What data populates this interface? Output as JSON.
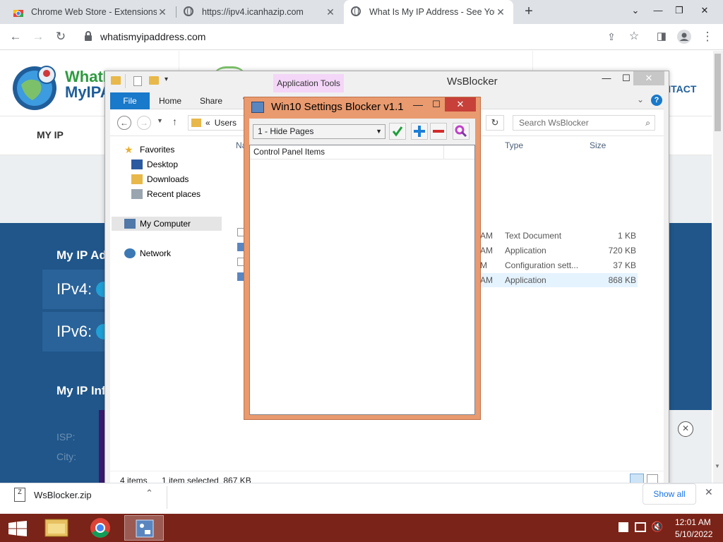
{
  "browser": {
    "tabs": [
      {
        "title": "Chrome Web Store - Extensions",
        "active": false
      },
      {
        "title": "https://ipv4.icanhazip.com",
        "active": false
      },
      {
        "title": "What Is My IP Address - See Your",
        "active": true
      }
    ],
    "new_tab": "+",
    "url": "whatismyipaddress.com"
  },
  "website": {
    "logo_text_line1": "WhatI",
    "logo_text_line2": "MyIPA",
    "nav_item": "MY IP",
    "nav_contact": "NTACT",
    "section_heading": "My IP Ad",
    "ipv4_label": "IPv4:",
    "ipv6_label": "IPv6:",
    "info_heading": "My IP Inf",
    "isp_label": "ISP:",
    "city_label": "City:"
  },
  "explorer": {
    "title": "WsBlocker",
    "context_tab": "Application Tools",
    "ribbon_tabs": [
      "File",
      "Home",
      "Share",
      "V"
    ],
    "breadcrumb_prefix": "«",
    "breadcrumb": "Users",
    "search_placeholder": "Search WsBlocker",
    "nav": {
      "favorites": "Favorites",
      "desktop": "Desktop",
      "downloads": "Downloads",
      "recent": "Recent places",
      "my_computer": "My Computer",
      "network": "Network"
    },
    "columns": {
      "name": "Na",
      "type": "Type",
      "size": "Size"
    },
    "files": [
      {
        "time": "AM",
        "type": "Text Document",
        "size": "1 KB"
      },
      {
        "time": "AM",
        "type": "Application",
        "size": "720 KB"
      },
      {
        "time": "M",
        "type": "Configuration sett...",
        "size": "37 KB"
      },
      {
        "time": "AM",
        "type": "Application",
        "size": "868 KB"
      }
    ],
    "status_items": "4 items",
    "status_selected": "1 item selected  867 KB"
  },
  "blocker": {
    "title": "Win10 Settings Blocker v1.1",
    "mode": "1 - Hide Pages",
    "list_header": "Control Panel Items"
  },
  "download_bar": {
    "file": "WsBlocker.zip",
    "show_all": "Show all"
  },
  "taskbar": {
    "time": "12:01 AM",
    "date": "5/10/2022"
  }
}
